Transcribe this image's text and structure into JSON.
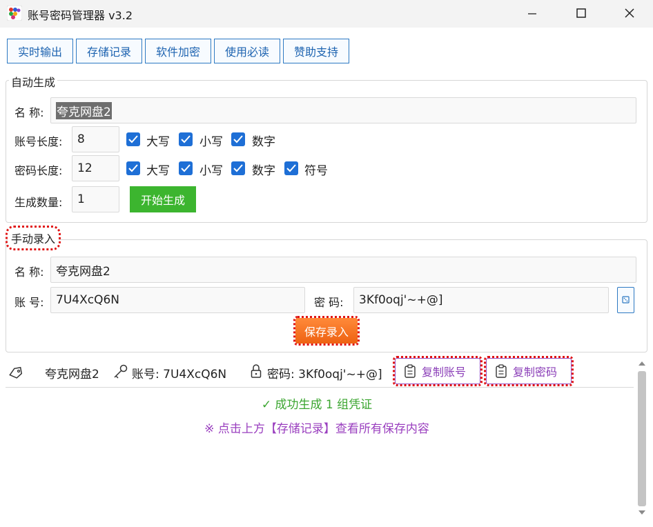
{
  "window": {
    "title": "账号密码管理器 v3.2",
    "icon": "app-logo-icon",
    "controls": [
      "minimize-icon",
      "maximize-icon",
      "close-icon"
    ]
  },
  "toolbar": {
    "tabs": [
      "实时输出",
      "存储记录",
      "软件加密",
      "使用必读",
      "赞助支持"
    ]
  },
  "auto": {
    "title": "自动生成",
    "name_label": "名 称:",
    "name_value": "夸克网盘2",
    "account_length_label": "账号长度:",
    "account_length": "8",
    "account_opts": [
      "大写",
      "小写",
      "数字"
    ],
    "password_length_label": "密码长度:",
    "password_length": "12",
    "password_opts": [
      "大写",
      "小写",
      "数字",
      "符号"
    ],
    "count_label": "生成数量:",
    "count": "1",
    "generate_label": "开始生成"
  },
  "manual": {
    "title": "手动录入",
    "name_label": "名 称:",
    "name_value": "夸克网盘2",
    "account_label": "账 号:",
    "account_value": "7U4XcQ6N",
    "password_label": "密 码:",
    "password_value": "3Kf0oqj'~+@]",
    "save_label": "保存录入"
  },
  "result": {
    "name": "夸克网盘2",
    "account": "账号: 7U4XcQ6N",
    "password": "密码: 3Kf0oqj'~+@]",
    "copy_account_label": "复制账号",
    "copy_password_label": "复制密码",
    "success_msg": "✓ 成功生成 1 组凭证",
    "hint_msg": "※ 点击上方【存储记录】查看所有保存内容"
  },
  "colors": {
    "accent_blue": "#1e6fd6",
    "green": "#3cb52f",
    "orange": "#ee6212",
    "purple": "#9a3fbf",
    "highlight_red": "#e01414"
  }
}
